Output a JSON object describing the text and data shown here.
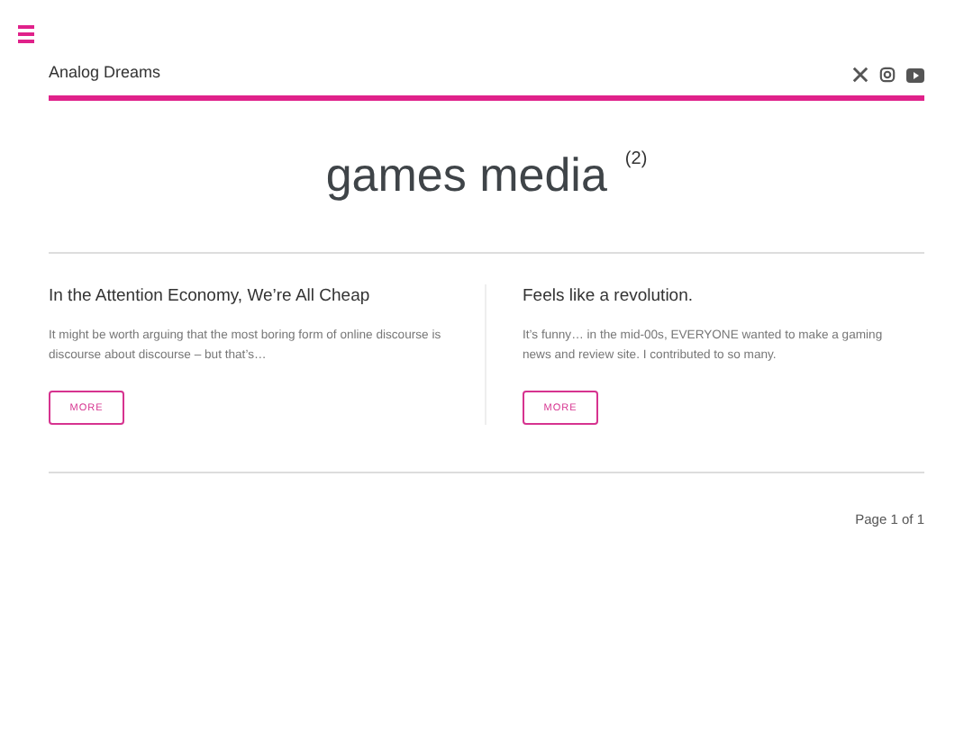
{
  "site": {
    "title": "Analog Dreams"
  },
  "archive": {
    "title": "games media",
    "count": "(2)"
  },
  "posts": [
    {
      "title": "In the Attention Economy, We’re All Cheap",
      "excerpt": "It might be worth arguing that the most boring form of online discourse is discourse about discourse – but that’s…",
      "button": "MORE"
    },
    {
      "title": "Feels like a revolution.",
      "excerpt": "It’s funny… in the mid-00s, EVERYONE wanted to make a gaming news and review site. I contributed to so many.",
      "button": "MORE"
    }
  ],
  "pagination": "Page 1 of 1"
}
